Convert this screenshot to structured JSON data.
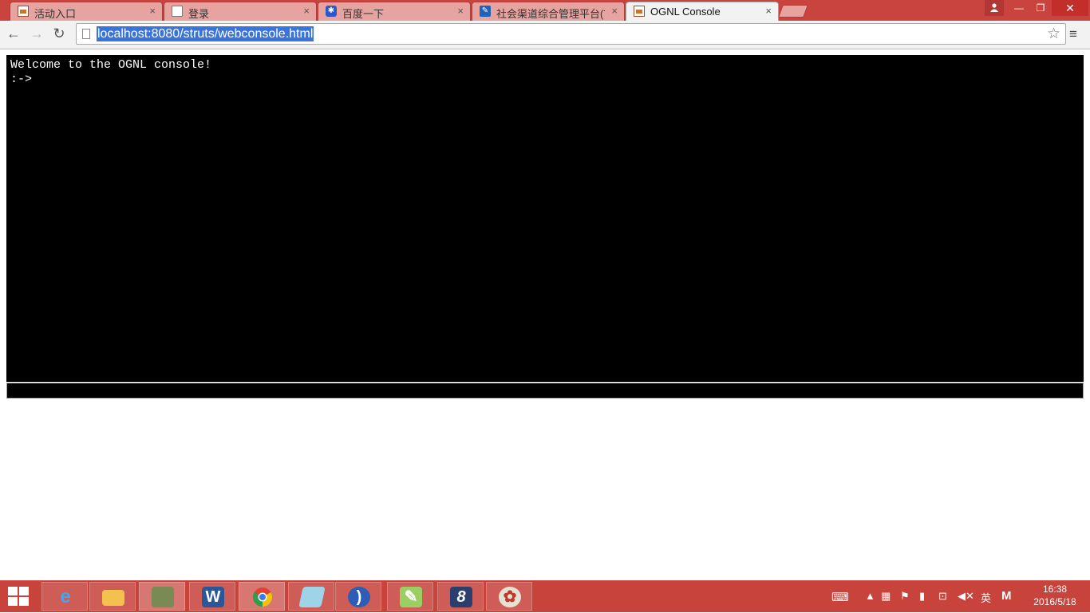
{
  "tabs": [
    {
      "label": "活动入口",
      "icon": "picture-favicon-icon",
      "close": "×"
    },
    {
      "label": "登录",
      "icon": "page-favicon-icon",
      "close": "×"
    },
    {
      "label": "百度一下",
      "icon": "baidu-paw-icon",
      "close": "×"
    },
    {
      "label": "社会渠道综合管理平台(TP",
      "icon": "channel-platform-icon",
      "close": "×"
    },
    {
      "label": "OGNL Console",
      "icon": "picture-favicon-icon",
      "close": "×",
      "active": true
    }
  ],
  "window_controls": {
    "minimize": "—",
    "maximize": "❐",
    "close": "✕"
  },
  "toolbar": {
    "back": "←",
    "forward": "→",
    "reload": "↻",
    "url": "localhost:8080/struts/webconsole.html",
    "bookmark": "☆",
    "menu": "≡"
  },
  "console": {
    "output": "Welcome to the OGNL console!\n:->",
    "input_value": ""
  },
  "taskbar": {
    "apps": [
      "internet-explorer",
      "file-explorer",
      "photo-app",
      "microsoft-word",
      "google-chrome",
      "notes-app",
      "media-app",
      "notepad-plus",
      "sublime-app",
      "paint-app"
    ],
    "tray": {
      "ime_lang": "英",
      "ime_mode": "M"
    },
    "clock": {
      "time": "16:38",
      "date": "2016/5/18"
    }
  },
  "colors": {
    "titlebar": "#c9443f",
    "taskbar": "#c7433c",
    "url_highlight": "#3a74d8",
    "console_bg": "#000000",
    "console_fg": "#ffffff"
  }
}
